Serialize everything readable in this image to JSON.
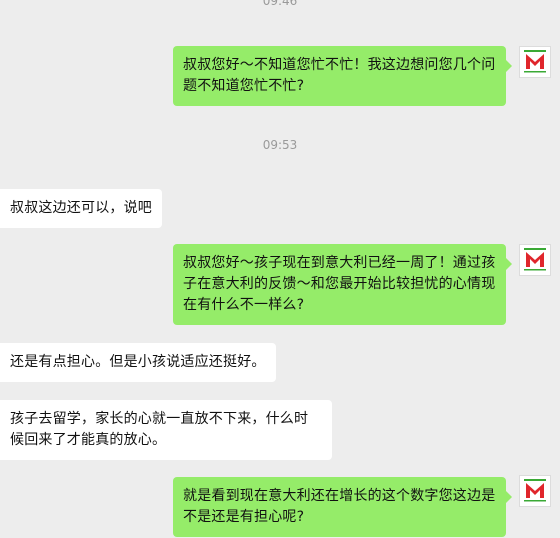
{
  "timestamps": [
    "09:46",
    "09:53"
  ],
  "messages": [
    {
      "side": "out",
      "text": "叔叔您好～不知道您忙不忙！我这边想问您几个问题不知道您忙不忙?"
    },
    {
      "side": "in",
      "text": "叔叔这边还可以，说吧"
    },
    {
      "side": "out",
      "text": "叔叔您好～孩子现在到意大利已经一周了！通过孩子在意大利的反馈～和您最开始比较担忧的心情现在有什么不一样么?"
    },
    {
      "side": "in",
      "text": "还是有点担心。但是小孩说适应还挺好。"
    },
    {
      "side": "in",
      "text": "孩子去留学，家长的心就一直放不下来，什么时候回来了才能真的放心。"
    },
    {
      "side": "out",
      "text": "就是看到现在意大利还在增长的这个数字您这边是不是还是有担心呢?"
    }
  ],
  "colors": {
    "background": "#ededed",
    "outgoing_bubble": "#95ec69",
    "incoming_bubble": "#ffffff",
    "timestamp": "#9a9a9a",
    "logo_red": "#e0262c",
    "logo_green": "#3aa935"
  },
  "avatar": {
    "icon": "school-logo-icon"
  }
}
